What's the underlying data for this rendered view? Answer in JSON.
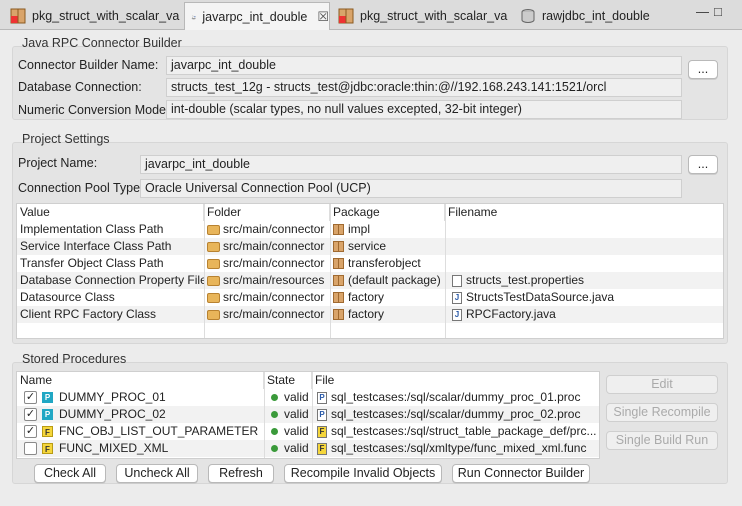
{
  "tabs": [
    {
      "label": "pkg_struct_with_scalar_va",
      "icon": "db-package-icon"
    },
    {
      "label": "javarpc_int_double",
      "icon": "java-rpc-icon",
      "close": "☒"
    },
    {
      "label": "pkg_struct_with_scalar_va",
      "icon": "db-package-icon"
    },
    {
      "label": "rawjdbc_int_double",
      "icon": "database-icon"
    }
  ],
  "window": {
    "minimize": "—",
    "maximize": "□"
  },
  "builder": {
    "title": "Java RPC Connector Builder",
    "name_label": "Connector Builder Name:",
    "name_value": "javarpc_int_double",
    "conn_label": "Database Connection:",
    "conn_value": "structs_test_12g - structs_test@jdbc:oracle:thin:@//192.168.243.141:1521/orcl",
    "numeric_label": "Numeric Conversion Model:",
    "numeric_value": "int-double (scalar types, no null values excepted, 32-bit integer)",
    "browse": "..."
  },
  "project": {
    "title": "Project Settings",
    "name_label": "Project Name:",
    "name_value": "javarpc_int_double",
    "pool_label": "Connection Pool Type:",
    "pool_value": "Oracle Universal Connection Pool (UCP)",
    "browse": "...",
    "columns": [
      "Value",
      "Folder",
      "Package",
      "Filename"
    ],
    "rows": [
      {
        "value": "Implementation Class Path",
        "folder": "src/main/connector",
        "package": "impl",
        "filename": ""
      },
      {
        "value": "Service Interface Class Path",
        "folder": "src/main/connector",
        "package": "service",
        "filename": ""
      },
      {
        "value": "Transfer Object Class Path",
        "folder": "src/main/connector",
        "package": "transferobject",
        "filename": ""
      },
      {
        "value": "Database Connection Property File",
        "folder": "src/main/resources",
        "package": "(default package)",
        "filename": "structs_test.properties"
      },
      {
        "value": "Datasource Class",
        "folder": "src/main/connector",
        "package": "factory",
        "filename": "StructsTestDataSource.java"
      },
      {
        "value": "Client RPC Factory Class",
        "folder": "src/main/connector",
        "package": "factory",
        "filename": "RPCFactory.java"
      }
    ]
  },
  "procedures": {
    "title": "Stored Procedures",
    "columns": [
      "Name",
      "State",
      "File"
    ],
    "rows": [
      {
        "checked": "✓",
        "type": "P",
        "name": "DUMMY_PROC_01",
        "state": "valid",
        "file": "sql_testcases:/sql/scalar/dummy_proc_01.proc"
      },
      {
        "checked": "✓",
        "type": "P",
        "name": "DUMMY_PROC_02",
        "state": "valid",
        "file": "sql_testcases:/sql/scalar/dummy_proc_02.proc"
      },
      {
        "checked": "✓",
        "type": "F",
        "name": "FNC_OBJ_LIST_OUT_PARAMETER",
        "state": "valid",
        "file": "sql_testcases:/sql/struct_table_package_def/prc..."
      },
      {
        "checked": "",
        "type": "F",
        "name": "FUNC_MIXED_XML",
        "state": "valid",
        "file": "sql_testcases:/sql/xmltype/func_mixed_xml.func"
      }
    ],
    "side_buttons": [
      "Edit",
      "Single Recompile",
      "Single Build Run"
    ],
    "bottom_buttons": [
      "Check All",
      "Uncheck All",
      "Refresh",
      "Recompile Invalid Objects",
      "Run Connector Builder"
    ]
  }
}
